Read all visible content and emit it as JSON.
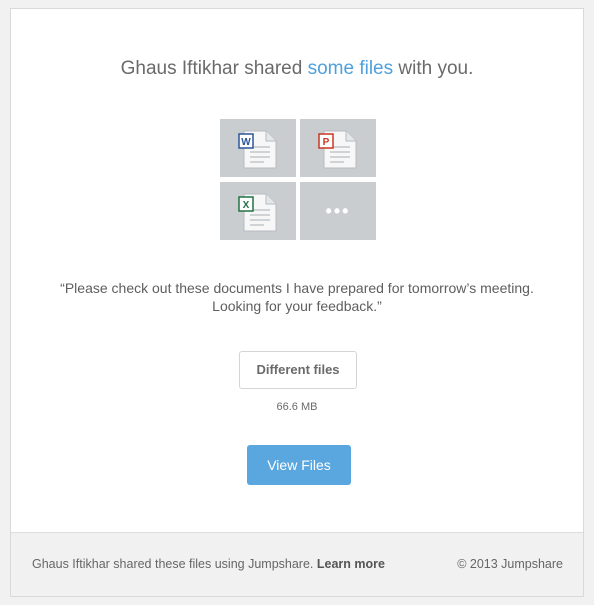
{
  "share": {
    "sender": "Ghaus Iftikhar",
    "action": "shared",
    "link_text": "some files",
    "suffix": "with you."
  },
  "files": {
    "icons": [
      "word-document-icon",
      "powerpoint-document-icon",
      "excel-document-icon",
      "more-files-icon"
    ],
    "badges": {
      "word": "W",
      "powerpoint": "P",
      "excel": "X"
    },
    "more_label": "•••",
    "colors": {
      "word": "#2b5797",
      "powerpoint": "#c8371f",
      "excel": "#207245",
      "tile": "#c9cdd0"
    }
  },
  "message": {
    "line1": "“Please check out these documents I have prepared for tomorrow’s meeting.",
    "line2": "Looking for your feedback.”"
  },
  "actions": {
    "files_button": "Different files",
    "size": "66.6 MB",
    "view_button": "View Files",
    "accent": "#5aa6de"
  },
  "footer": {
    "text": "Ghaus Iftikhar shared these files using Jumpshare.",
    "learn_more": "Learn more",
    "copyright": "© 2013 Jumpshare"
  }
}
